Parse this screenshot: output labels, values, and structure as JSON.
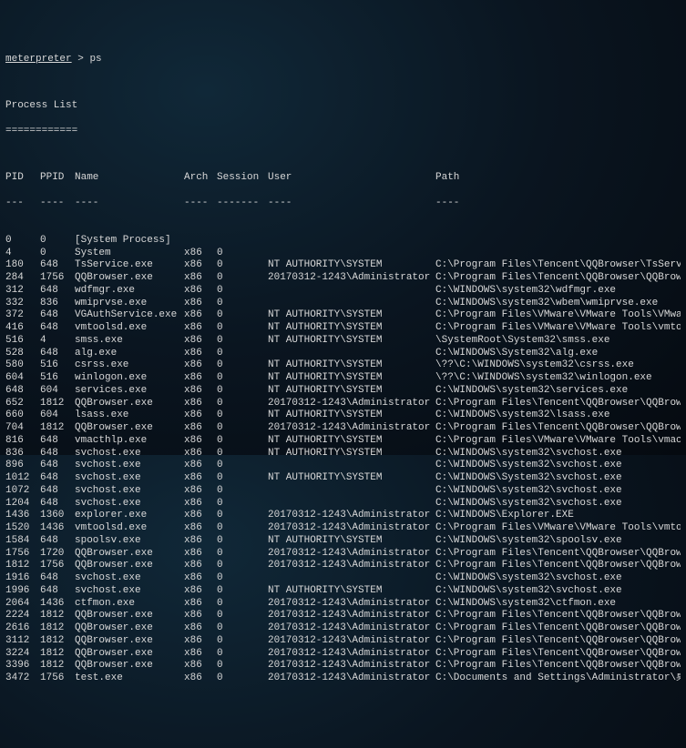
{
  "prompt": "meterpreter",
  "command": "ps",
  "title": "Process List",
  "rule": "============",
  "headers": {
    "pid": "PID",
    "ppid": "PPID",
    "name": "Name",
    "arch": "Arch",
    "session": "Session",
    "user": "User",
    "path": "Path"
  },
  "dashes": {
    "pid": "---",
    "ppid": "----",
    "name": "----",
    "arch": "----",
    "session": "-------",
    "user": "----",
    "path": "----"
  },
  "processes": [
    {
      "pid": "0",
      "ppid": "0",
      "name": "[System Process]",
      "arch": "",
      "session": "",
      "user": "",
      "path": ""
    },
    {
      "pid": "4",
      "ppid": "0",
      "name": "System",
      "arch": "x86",
      "session": "0",
      "user": "",
      "path": ""
    },
    {
      "pid": "180",
      "ppid": "648",
      "name": "TsService.exe",
      "arch": "x86",
      "session": "0",
      "user": "NT AUTHORITY\\SYSTEM",
      "path": "C:\\Program Files\\Tencent\\QQBrowser\\TsService.exe"
    },
    {
      "pid": "284",
      "ppid": "1756",
      "name": "QQBrowser.exe",
      "arch": "x86",
      "session": "0",
      "user": "20170312-1243\\Administrator",
      "path": "C:\\Program Files\\Tencent\\QQBrowser\\QQBrowser.exe"
    },
    {
      "pid": "312",
      "ppid": "648",
      "name": "wdfmgr.exe",
      "arch": "x86",
      "session": "0",
      "user": "",
      "path": "C:\\WINDOWS\\system32\\wdfmgr.exe"
    },
    {
      "pid": "332",
      "ppid": "836",
      "name": "wmiprvse.exe",
      "arch": "x86",
      "session": "0",
      "user": "",
      "path": "C:\\WINDOWS\\system32\\wbem\\wmiprvse.exe"
    },
    {
      "pid": "372",
      "ppid": "648",
      "name": "VGAuthService.exe",
      "arch": "x86",
      "session": "0",
      "user": "NT AUTHORITY\\SYSTEM",
      "path": "C:\\Program Files\\VMware\\VMware Tools\\VMware VGAuth\\VGAut"
    },
    {
      "pid": "416",
      "ppid": "648",
      "name": "vmtoolsd.exe",
      "arch": "x86",
      "session": "0",
      "user": "NT AUTHORITY\\SYSTEM",
      "path": "C:\\Program Files\\VMware\\VMware Tools\\vmtoolsd.exe"
    },
    {
      "pid": "516",
      "ppid": "4",
      "name": "smss.exe",
      "arch": "x86",
      "session": "0",
      "user": "NT AUTHORITY\\SYSTEM",
      "path": "\\SystemRoot\\System32\\smss.exe"
    },
    {
      "pid": "528",
      "ppid": "648",
      "name": "alg.exe",
      "arch": "x86",
      "session": "0",
      "user": "",
      "path": "C:\\WINDOWS\\System32\\alg.exe"
    },
    {
      "pid": "580",
      "ppid": "516",
      "name": "csrss.exe",
      "arch": "x86",
      "session": "0",
      "user": "NT AUTHORITY\\SYSTEM",
      "path": "\\??\\C:\\WINDOWS\\system32\\csrss.exe"
    },
    {
      "pid": "604",
      "ppid": "516",
      "name": "winlogon.exe",
      "arch": "x86",
      "session": "0",
      "user": "NT AUTHORITY\\SYSTEM",
      "path": "\\??\\C:\\WINDOWS\\system32\\winlogon.exe"
    },
    {
      "pid": "648",
      "ppid": "604",
      "name": "services.exe",
      "arch": "x86",
      "session": "0",
      "user": "NT AUTHORITY\\SYSTEM",
      "path": "C:\\WINDOWS\\system32\\services.exe"
    },
    {
      "pid": "652",
      "ppid": "1812",
      "name": "QQBrowser.exe",
      "arch": "x86",
      "session": "0",
      "user": "20170312-1243\\Administrator",
      "path": "C:\\Program Files\\Tencent\\QQBrowser\\QQBrowser.exe"
    },
    {
      "pid": "660",
      "ppid": "604",
      "name": "lsass.exe",
      "arch": "x86",
      "session": "0",
      "user": "NT AUTHORITY\\SYSTEM",
      "path": "C:\\WINDOWS\\system32\\lsass.exe"
    },
    {
      "pid": "704",
      "ppid": "1812",
      "name": "QQBrowser.exe",
      "arch": "x86",
      "session": "0",
      "user": "20170312-1243\\Administrator",
      "path": "C:\\Program Files\\Tencent\\QQBrowser\\QQBrowser.exe"
    },
    {
      "pid": "816",
      "ppid": "648",
      "name": "vmacthlp.exe",
      "arch": "x86",
      "session": "0",
      "user": "NT AUTHORITY\\SYSTEM",
      "path": "C:\\Program Files\\VMware\\VMware Tools\\vmacthlp.exe"
    },
    {
      "pid": "836",
      "ppid": "648",
      "name": "svchost.exe",
      "arch": "x86",
      "session": "0",
      "user": "NT AUTHORITY\\SYSTEM",
      "path": "C:\\WINDOWS\\system32\\svchost.exe"
    },
    {
      "pid": "896",
      "ppid": "648",
      "name": "svchost.exe",
      "arch": "x86",
      "session": "0",
      "user": "",
      "path": "C:\\WINDOWS\\system32\\svchost.exe"
    },
    {
      "pid": "1012",
      "ppid": "648",
      "name": "svchost.exe",
      "arch": "x86",
      "session": "0",
      "user": "NT AUTHORITY\\SYSTEM",
      "path": "C:\\WINDOWS\\System32\\svchost.exe"
    },
    {
      "pid": "1072",
      "ppid": "648",
      "name": "svchost.exe",
      "arch": "x86",
      "session": "0",
      "user": "",
      "path": "C:\\WINDOWS\\system32\\svchost.exe"
    },
    {
      "pid": "1204",
      "ppid": "648",
      "name": "svchost.exe",
      "arch": "x86",
      "session": "0",
      "user": "",
      "path": "C:\\WINDOWS\\system32\\svchost.exe"
    },
    {
      "pid": "1436",
      "ppid": "1360",
      "name": "explorer.exe",
      "arch": "x86",
      "session": "0",
      "user": "20170312-1243\\Administrator",
      "path": "C:\\WINDOWS\\Explorer.EXE"
    },
    {
      "pid": "1520",
      "ppid": "1436",
      "name": "vmtoolsd.exe",
      "arch": "x86",
      "session": "0",
      "user": "20170312-1243\\Administrator",
      "path": "C:\\Program Files\\VMware\\VMware Tools\\vmtoolsd.exe"
    },
    {
      "pid": "1584",
      "ppid": "648",
      "name": "spoolsv.exe",
      "arch": "x86",
      "session": "0",
      "user": "NT AUTHORITY\\SYSTEM",
      "path": "C:\\WINDOWS\\system32\\spoolsv.exe"
    },
    {
      "pid": "1756",
      "ppid": "1720",
      "name": "QQBrowser.exe",
      "arch": "x86",
      "session": "0",
      "user": "20170312-1243\\Administrator",
      "path": "C:\\Program Files\\Tencent\\QQBrowser\\QQBrowser.exe"
    },
    {
      "pid": "1812",
      "ppid": "1756",
      "name": "QQBrowser.exe",
      "arch": "x86",
      "session": "0",
      "user": "20170312-1243\\Administrator",
      "path": "C:\\Program Files\\Tencent\\QQBrowser\\QQBrowser.exe"
    },
    {
      "pid": "1916",
      "ppid": "648",
      "name": "svchost.exe",
      "arch": "x86",
      "session": "0",
      "user": "",
      "path": "C:\\WINDOWS\\system32\\svchost.exe"
    },
    {
      "pid": "1996",
      "ppid": "648",
      "name": "svchost.exe",
      "arch": "x86",
      "session": "0",
      "user": "NT AUTHORITY\\SYSTEM",
      "path": "C:\\WINDOWS\\system32\\svchost.exe"
    },
    {
      "pid": "2064",
      "ppid": "1436",
      "name": "ctfmon.exe",
      "arch": "x86",
      "session": "0",
      "user": "20170312-1243\\Administrator",
      "path": "C:\\WINDOWS\\system32\\ctfmon.exe"
    },
    {
      "pid": "2224",
      "ppid": "1812",
      "name": "QQBrowser.exe",
      "arch": "x86",
      "session": "0",
      "user": "20170312-1243\\Administrator",
      "path": "C:\\Program Files\\Tencent\\QQBrowser\\QQBrowser.exe"
    },
    {
      "pid": "2616",
      "ppid": "1812",
      "name": "QQBrowser.exe",
      "arch": "x86",
      "session": "0",
      "user": "20170312-1243\\Administrator",
      "path": "C:\\Program Files\\Tencent\\QQBrowser\\QQBrowser.exe"
    },
    {
      "pid": "3112",
      "ppid": "1812",
      "name": "QQBrowser.exe",
      "arch": "x86",
      "session": "0",
      "user": "20170312-1243\\Administrator",
      "path": "C:\\Program Files\\Tencent\\QQBrowser\\QQBrowser.exe"
    },
    {
      "pid": "3224",
      "ppid": "1812",
      "name": "QQBrowser.exe",
      "arch": "x86",
      "session": "0",
      "user": "20170312-1243\\Administrator",
      "path": "C:\\Program Files\\Tencent\\QQBrowser\\QQBrowser.exe"
    },
    {
      "pid": "3396",
      "ppid": "1812",
      "name": "QQBrowser.exe",
      "arch": "x86",
      "session": "0",
      "user": "20170312-1243\\Administrator",
      "path": "C:\\Program Files\\Tencent\\QQBrowser\\QQBrowser.exe"
    },
    {
      "pid": "3472",
      "ppid": "1756",
      "name": "test.exe",
      "arch": "x86",
      "session": "0",
      "user": "20170312-1243\\Administrator",
      "path": "C:\\Documents and Settings\\Administrator\\桌面\\test.exe"
    }
  ]
}
